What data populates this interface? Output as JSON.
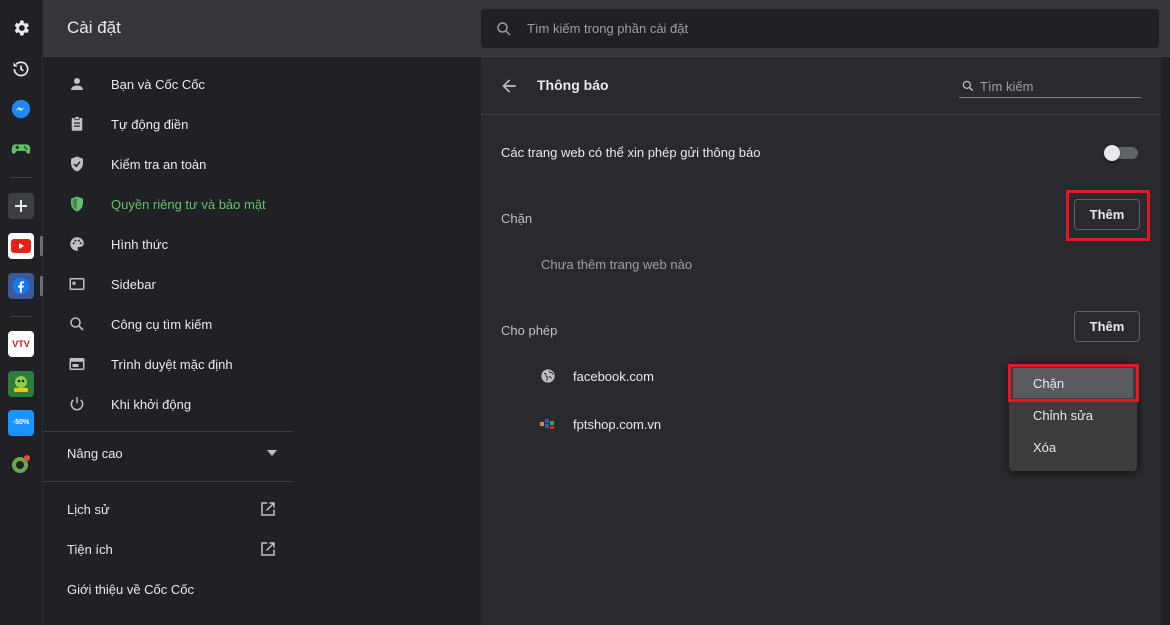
{
  "header": {
    "title": "Cài đặt",
    "search_placeholder": "Tìm kiếm trong phần cài đặt"
  },
  "rail": {
    "icons": [
      "settings-icon",
      "history-icon",
      "messenger-icon",
      "gamepad-icon",
      "add-icon",
      "youtube-icon",
      "facebook-icon",
      "vtv-go-icon",
      "game-app-icon",
      "tiki-icon",
      "cococ-icon"
    ],
    "tiki_badge": "-50%",
    "vtv_label": "VTV"
  },
  "nav": {
    "items": [
      {
        "label": "Bạn và Cốc Cốc",
        "icon": "person-icon"
      },
      {
        "label": "Tự động điền",
        "icon": "clipboard-icon"
      },
      {
        "label": "Kiểm tra an toàn",
        "icon": "shield-check-icon"
      },
      {
        "label": "Quyền riêng tư và bảo mật",
        "icon": "shield-icon",
        "active": true
      },
      {
        "label": "Hình thức",
        "icon": "palette-icon"
      },
      {
        "label": "Sidebar",
        "icon": "sidebar-icon"
      },
      {
        "label": "Công cụ tìm kiếm",
        "icon": "search-icon"
      },
      {
        "label": "Trình duyệt mặc định",
        "icon": "browser-icon"
      },
      {
        "label": "Khi khởi động",
        "icon": "power-icon"
      }
    ],
    "advanced": "Nâng cao",
    "history": "Lịch sử",
    "extensions": "Tiện ích",
    "about": "Giới thiệu về Cốc Cốc"
  },
  "main": {
    "title": "Thông báo",
    "search_placeholder": "Tìm kiếm",
    "ask_permission": "Các trang web có thể xin phép gửi thông báo",
    "block_section": "Chặn",
    "block_add": "Thêm",
    "block_empty": "Chưa thêm trang web nào",
    "allow_section": "Cho phép",
    "allow_add": "Thêm",
    "allowed_sites": [
      "facebook.com",
      "fptshop.com.vn"
    ]
  },
  "menu": {
    "items": [
      "Chặn",
      "Chỉnh sửa",
      "Xóa"
    ]
  },
  "colors": {
    "accent_green": "#5ec26a",
    "highlight_red": "#e3191f"
  }
}
